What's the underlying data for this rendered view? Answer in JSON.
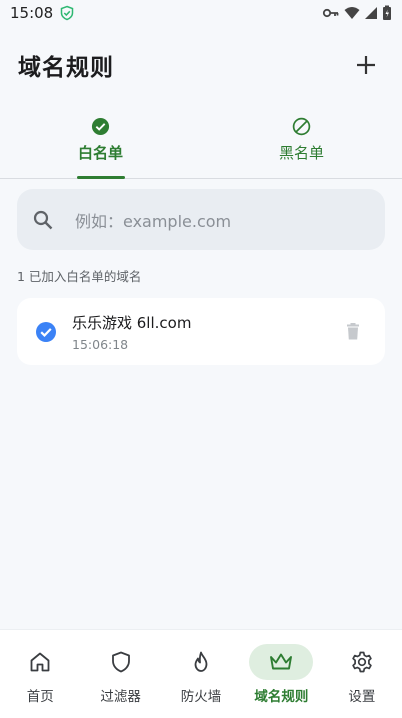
{
  "status_bar": {
    "time": "15:08"
  },
  "header": {
    "title": "域名规则",
    "add_icon": "plus-icon"
  },
  "tabs": [
    {
      "label": "白名单",
      "icon": "check-circle-icon",
      "active": true
    },
    {
      "label": "黑名单",
      "icon": "block-icon",
      "active": false
    }
  ],
  "search": {
    "placeholder": "例如：example.com"
  },
  "summary": {
    "count_text": "1 已加入白名单的域名"
  },
  "domains": [
    {
      "name": "乐乐游戏 6ll.com",
      "time": "15:06:18",
      "checked": true
    }
  ],
  "bottom_nav": [
    {
      "label": "首页",
      "icon": "home-icon",
      "active": false
    },
    {
      "label": "过滤器",
      "icon": "shield-icon",
      "active": false
    },
    {
      "label": "防火墙",
      "icon": "flame-icon",
      "active": false
    },
    {
      "label": "域名规则",
      "icon": "crown-icon",
      "active": true
    },
    {
      "label": "设置",
      "icon": "gear-icon",
      "active": false
    }
  ],
  "colors": {
    "accent": "#2e7d32",
    "checkbox": "#3b82f6",
    "background": "#f6f8fb"
  }
}
